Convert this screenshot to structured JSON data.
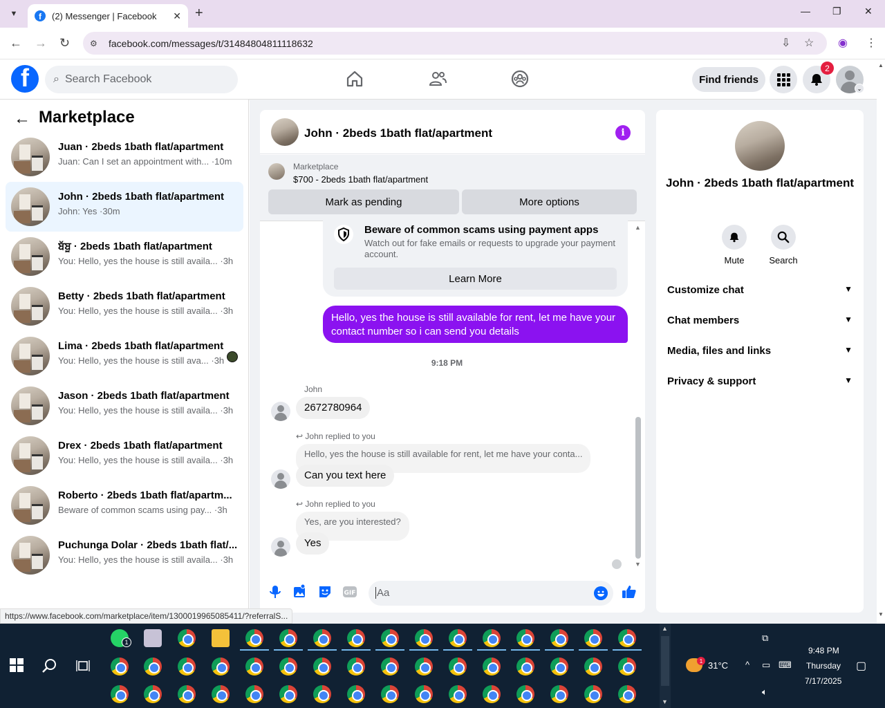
{
  "browser": {
    "tab_title": "(2) Messenger | Facebook",
    "url": "facebook.com/messages/t/31484804811118632",
    "status_url": "https://www.facebook.com/marketplace/item/1300019965085411/?referralS..."
  },
  "fb_header": {
    "logo": "f",
    "search_placeholder": "Search Facebook",
    "find_friends": "Find friends",
    "notification_count": "2",
    "nav_icons": [
      "home-icon",
      "friends-icon",
      "groups-icon"
    ]
  },
  "sidebar": {
    "title": "Marketplace",
    "conversations": [
      {
        "name": "Juan · 2beds 1bath flat/apartment",
        "preview": "Juan: Can I set an appointment with... ·10m"
      },
      {
        "name": "John · 2beds 1bath flat/apartment",
        "preview": "John: Yes ·30m"
      },
      {
        "name": "ਬੱਬੂ · 2beds 1bath flat/apartment",
        "preview": "You: Hello, yes the house is still availa... ·3h"
      },
      {
        "name": "Betty · 2beds 1bath flat/apartment",
        "preview": "You: Hello, yes the house is still availa... ·3h"
      },
      {
        "name": "Lima · 2beds 1bath flat/apartment",
        "preview": "You: Hello, yes the house is still ava... ·3h"
      },
      {
        "name": "Jason · 2beds 1bath flat/apartment",
        "preview": "You: Hello, yes the house is still availa... ·3h"
      },
      {
        "name": "Drex · 2beds 1bath flat/apartment",
        "preview": "You: Hello, yes the house is still availa... ·3h"
      },
      {
        "name": "Roberto · 2beds 1bath flat/apartm...",
        "preview": "Beware of common scams using pay... ·3h"
      },
      {
        "name": "Puchunga Dolar · 2beds 1bath flat/...",
        "preview": "You: Hello, yes the house is still availa... ·3h"
      }
    ]
  },
  "chat": {
    "title": "John · 2beds 1bath flat/apartment",
    "marketplace_label": "Marketplace",
    "listing": "$700 - 2beds 1bath flat/apartment",
    "mark_pending": "Mark as pending",
    "more_options": "More options",
    "scam_title": "Beware of common scams using payment apps",
    "scam_desc": "Watch out for fake emails or requests to upgrade your payment account.",
    "learn_more": "Learn More",
    "outgoing_message": "Hello, yes the house is still available for rent, let me have your contact number so i can send you details",
    "timestamp": "9:18 PM",
    "sender": "John",
    "msg1": "2672780964",
    "replied1": "John replied to you",
    "quote1": "Hello, yes the house is still available for rent, let me have your conta...",
    "msg2": "Can you text here",
    "replied2": "John replied to you",
    "quote2": "Yes, are you interested?",
    "msg3": "Yes",
    "composer_placeholder": "Aa"
  },
  "info_panel": {
    "name": "John · 2beds 1bath flat/apartment",
    "mute": "Mute",
    "search": "Search",
    "sections": [
      "Customize chat",
      "Chat members",
      "Media, files and links",
      "Privacy & support"
    ]
  },
  "taskbar": {
    "weather_temp": "31°C",
    "weather_badge": "1",
    "whatsapp_badge": "1",
    "time": "9:48 PM",
    "day": "Thursday",
    "date": "7/17/2025"
  },
  "colors": {
    "fb_blue": "#0866ff",
    "purple_bubble": "#8b12f0",
    "badge_red": "#e41e3f",
    "taskbar": "#102133"
  }
}
